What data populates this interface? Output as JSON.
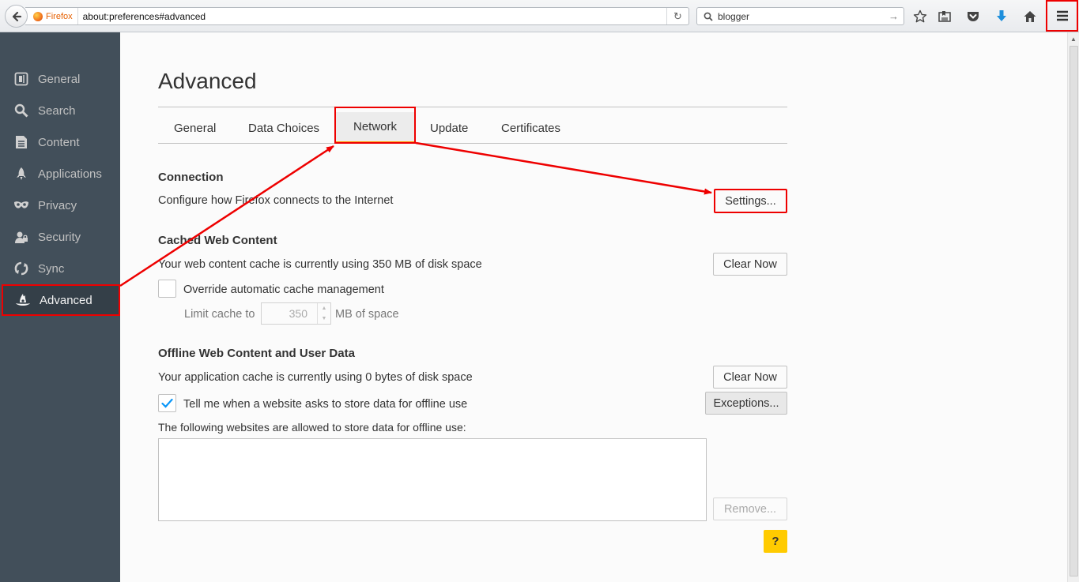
{
  "toolbar": {
    "identity_label": "Firefox",
    "url": "about:preferences#advanced",
    "search_query": "blogger"
  },
  "sidebar": {
    "items": [
      {
        "label": "General",
        "icon": "general-icon"
      },
      {
        "label": "Search",
        "icon": "search-icon"
      },
      {
        "label": "Content",
        "icon": "content-icon"
      },
      {
        "label": "Applications",
        "icon": "applications-icon"
      },
      {
        "label": "Privacy",
        "icon": "privacy-mask-icon"
      },
      {
        "label": "Security",
        "icon": "security-icon"
      },
      {
        "label": "Sync",
        "icon": "sync-icon"
      },
      {
        "label": "Advanced",
        "icon": "advanced-wizard-hat-icon",
        "selected": true
      }
    ]
  },
  "main": {
    "title": "Advanced",
    "tabs": [
      {
        "label": "General"
      },
      {
        "label": "Data Choices"
      },
      {
        "label": "Network",
        "selected": true
      },
      {
        "label": "Update"
      },
      {
        "label": "Certificates"
      }
    ],
    "connection": {
      "caption": "Connection",
      "description": "Configure how Firefox connects to the Internet",
      "settings_button": "Settings..."
    },
    "cache": {
      "caption": "Cached Web Content",
      "usage": "Your web content cache is currently using 350 MB of disk space",
      "clear_button": "Clear Now",
      "override_label": "Override automatic cache management",
      "override_checked": false,
      "limit_label": "Limit cache to",
      "limit_value": "350",
      "limit_unit": "MB of space"
    },
    "offline": {
      "caption": "Offline Web Content and User Data",
      "usage": "Your application cache is currently using 0 bytes of disk space",
      "clear_button": "Clear Now",
      "tell_me_label": "Tell me when a website asks to store data for offline use",
      "tell_me_checked": true,
      "exceptions_button": "Exceptions...",
      "allowed_label": "The following websites are allowed to store data for offline use:",
      "remove_button": "Remove...",
      "help_button": "?"
    }
  },
  "colors": {
    "sidebar_bg": "#424f5a",
    "accent_orange": "#ff9500",
    "annotation_red": "#e00000",
    "help_yellow": "#ffcb00",
    "check_blue": "#0996f8"
  }
}
